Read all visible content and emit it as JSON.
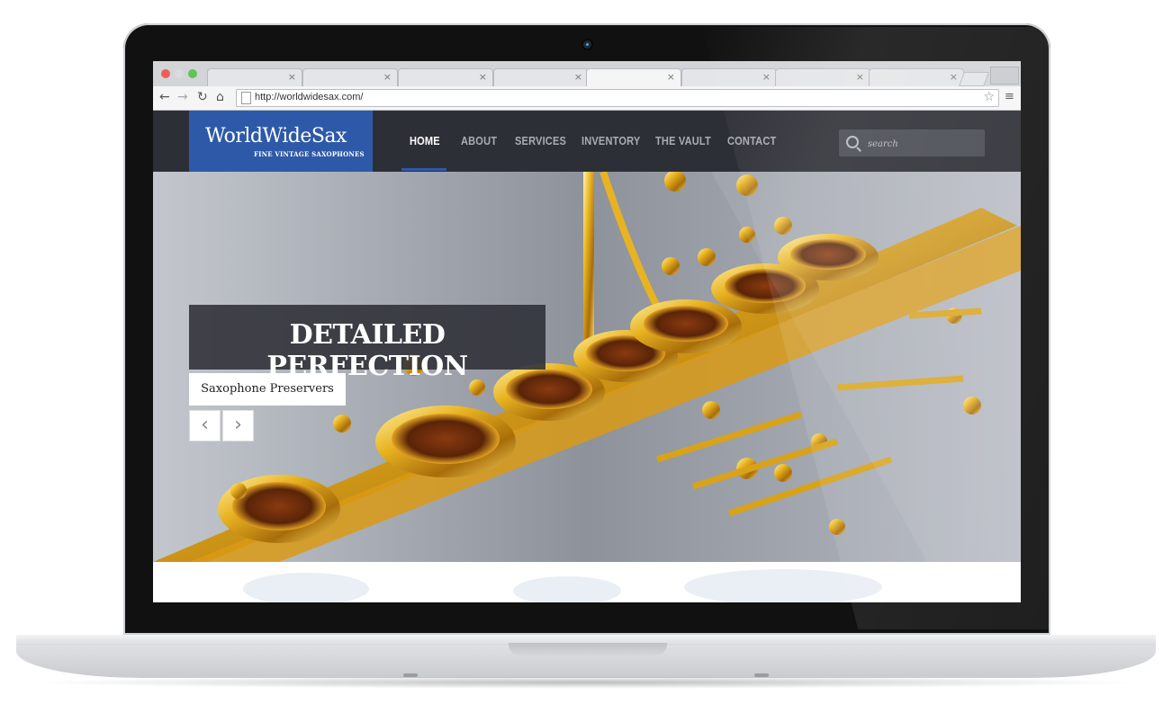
{
  "browser": {
    "url": "http://worldwidesax.com/",
    "tab_count": 8
  },
  "site": {
    "logo_title": "WorldWideSax",
    "logo_subtitle": "FINE VINTAGE SAXOPHONES",
    "nav": [
      {
        "label": "HOME",
        "active": true
      },
      {
        "label": "ABOUT"
      },
      {
        "label": "SERVICES"
      },
      {
        "label": "INVENTORY"
      },
      {
        "label": "THE VAULT"
      },
      {
        "label": "CONTACT"
      }
    ],
    "search_placeholder": "search"
  },
  "hero": {
    "title": "DETAILED PERFECTION",
    "subtitle": "Saxophone Preservers"
  },
  "colors": {
    "brand_blue": "#2e59a8",
    "header_dark": "#2d2f36"
  },
  "icons": [
    "back-icon",
    "forward-icon",
    "reload-icon",
    "home-icon",
    "page-icon",
    "star-icon",
    "menu-icon",
    "search-icon",
    "chevron-left-icon",
    "chevron-right-icon",
    "camera-icon"
  ]
}
